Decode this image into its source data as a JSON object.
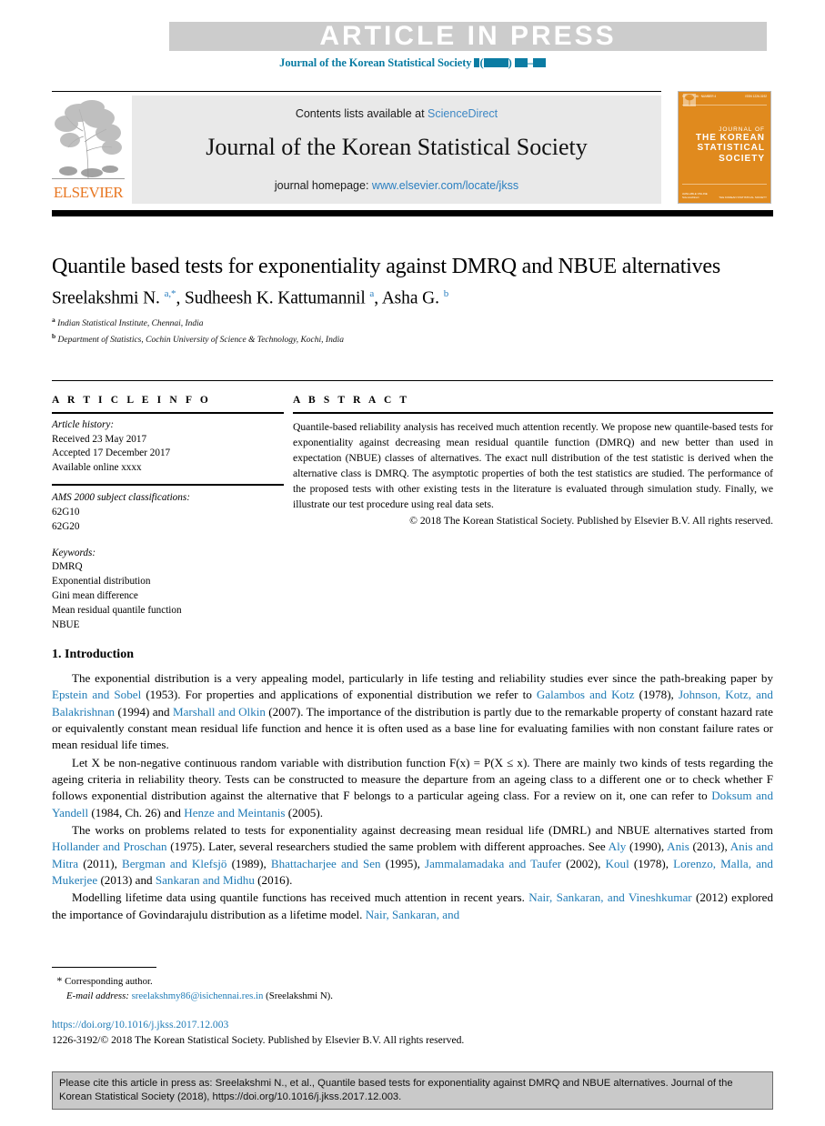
{
  "banner": {
    "text": "ARTICLE IN PRESS",
    "journal_ref_prefix": "Journal of the Korean Statistical Society",
    "bg_color": "#cccccc",
    "ref_color": "#0b7ca3"
  },
  "masthead": {
    "contents_label": "Contents lists available at",
    "sciencedirect": "ScienceDirect",
    "journal_title": "Journal of the Korean Statistical Society",
    "homepage_label": "journal homepage:",
    "homepage_url": "www.elsevier.com/locate/jkss",
    "publisher": "ELSEVIER",
    "publisher_color": "#e87722",
    "link_color": "#3d87c4",
    "cover": {
      "line1": "JOURNAL OF",
      "line2": "THE KOREAN",
      "line3": "STATISTICAL",
      "line4": "SOCIETY",
      "bg_color": "#e08a1e"
    }
  },
  "article": {
    "title": "Quantile based tests for exponentiality against DMRQ and NBUE alternatives",
    "authors_html": "Sreelakshmi N. <sup>a,*</sup>, Sudheesh K. Kattumannil <sup>a</sup>, Asha G. <sup>b</sup>",
    "affiliation_a": "Indian Statistical Institute, Chennai, India",
    "affiliation_b": "Department of Statistics, Cochin University of Science & Technology, Kochi, India"
  },
  "article_info": {
    "heading": "A R T I C L E   I N F O",
    "history_label": "Article history:",
    "received": "Received 23 May 2017",
    "accepted": "Accepted 17 December 2017",
    "available": "Available online xxxx",
    "ams_label": "AMS 2000 subject classifications:",
    "ams_codes": [
      "62G10",
      "62G20"
    ],
    "keywords_label": "Keywords:",
    "keywords": [
      "DMRQ",
      "Exponential distribution",
      "Gini mean difference",
      "Mean residual quantile function",
      "NBUE"
    ]
  },
  "abstract": {
    "heading": "A B S T R A C T",
    "text": "Quantile-based reliability analysis has received much attention recently. We propose new quantile-based tests for exponentiality against decreasing mean residual quantile function (DMRQ) and new better than used in expectation (NBUE) classes of alternatives. The exact null distribution of the test statistic is derived when the alternative class is DMRQ. The asymptotic properties of both the test statistics are studied. The performance of the proposed tests with other existing tests in the literature is evaluated through simulation study. Finally, we illustrate our test procedure using real data sets.",
    "copyright": "© 2018 The Korean Statistical Society. Published by Elsevier B.V. All rights reserved."
  },
  "introduction": {
    "heading": "1. Introduction",
    "p1_a": "The exponential distribution is a very appealing model, particularly in life testing and reliability studies ever since the path-breaking paper by ",
    "p1_c1": "Epstein and Sobel",
    "p1_b": " (1953). For properties and applications of exponential distribution we refer  to ",
    "p1_c2": "Galambos and Kotz",
    "p1_d": " (1978), ",
    "p1_c3": "Johnson, Kotz, and Balakrishnan",
    "p1_e": " (1994) and ",
    "p1_c4": "Marshall and Olkin",
    "p1_f": " (2007). The importance of the distribution is partly due to the remarkable property of constant hazard rate or equivalently constant mean residual life function and hence it is often used as a base line for evaluating families with non constant failure rates or mean residual life times.",
    "p2_a": "Let X be non-negative continuous random variable with distribution function F(x) = P(X ≤ x). There are mainly two kinds of tests regarding the ageing criteria in reliability theory. Tests can be constructed to measure the departure from an ageing class to a different one or to check whether F follows exponential distribution against the alternative that F belongs to a particular ageing class. For a review on it, one can refer to ",
    "p2_c1": "Doksum and Yandell",
    "p2_b": " (1984, Ch. 26) and ",
    "p2_c2": "Henze and Meintanis",
    "p2_c": " (2005).",
    "p3_a": "The works on problems related to tests for exponentiality against decreasing mean residual life (DMRL) and NBUE alternatives started from ",
    "p3_c1": "Hollander and Proschan",
    "p3_b": " (1975). Later, several researchers studied the same problem with different approaches. See ",
    "p3_c2": "Aly",
    "p3_c": " (1990), ",
    "p3_c3": "Anis",
    "p3_d": " (2013), ",
    "p3_c4": "Anis and Mitra",
    "p3_e": " (2011), ",
    "p3_c5": "Bergman and Klefsjö",
    "p3_f": " (1989), ",
    "p3_c6": "Bhattacharjee and Sen",
    "p3_g": " (1995), ",
    "p3_c7": "Jammalamadaka and Taufer",
    "p3_h": " (2002), ",
    "p3_c8": "Koul",
    "p3_i": " (1978), ",
    "p3_c9": "Lorenzo, Malla, and Mukerjee",
    "p3_j": " (2013) and ",
    "p3_c10": "Sankaran and Midhu",
    "p3_k": " (2016).",
    "p4_a": "Modelling lifetime data using quantile functions has received much attention in recent years. ",
    "p4_c1": "Nair, Sankaran, and Vineshkumar",
    "p4_b": " (2012) explored the importance of Govindarajulu distribution as a lifetime model. ",
    "p4_c2": "Nair, Sankaran, and",
    "link_color": "#1f7bb6"
  },
  "footer": {
    "corresponding_marker": "*",
    "corresponding_label": "Corresponding author.",
    "email_label": "E-mail address:",
    "email": "sreelakshmy86@isichennai.res.in",
    "email_owner": "(Sreelakshmi N).",
    "doi": "https://doi.org/10.1016/j.jkss.2017.12.003",
    "issn_line": "1226-3192/© 2018 The Korean Statistical Society. Published by Elsevier B.V. All rights reserved."
  },
  "cite_box": {
    "text": "Please cite this article in press as: Sreelakshmi N., et al., Quantile based tests for exponentiality against DMRQ and NBUE alternatives. Journal of the Korean Statistical Society (2018), https://doi.org/10.1016/j.jkss.2017.12.003.",
    "bg_color": "#c9c9c9"
  }
}
